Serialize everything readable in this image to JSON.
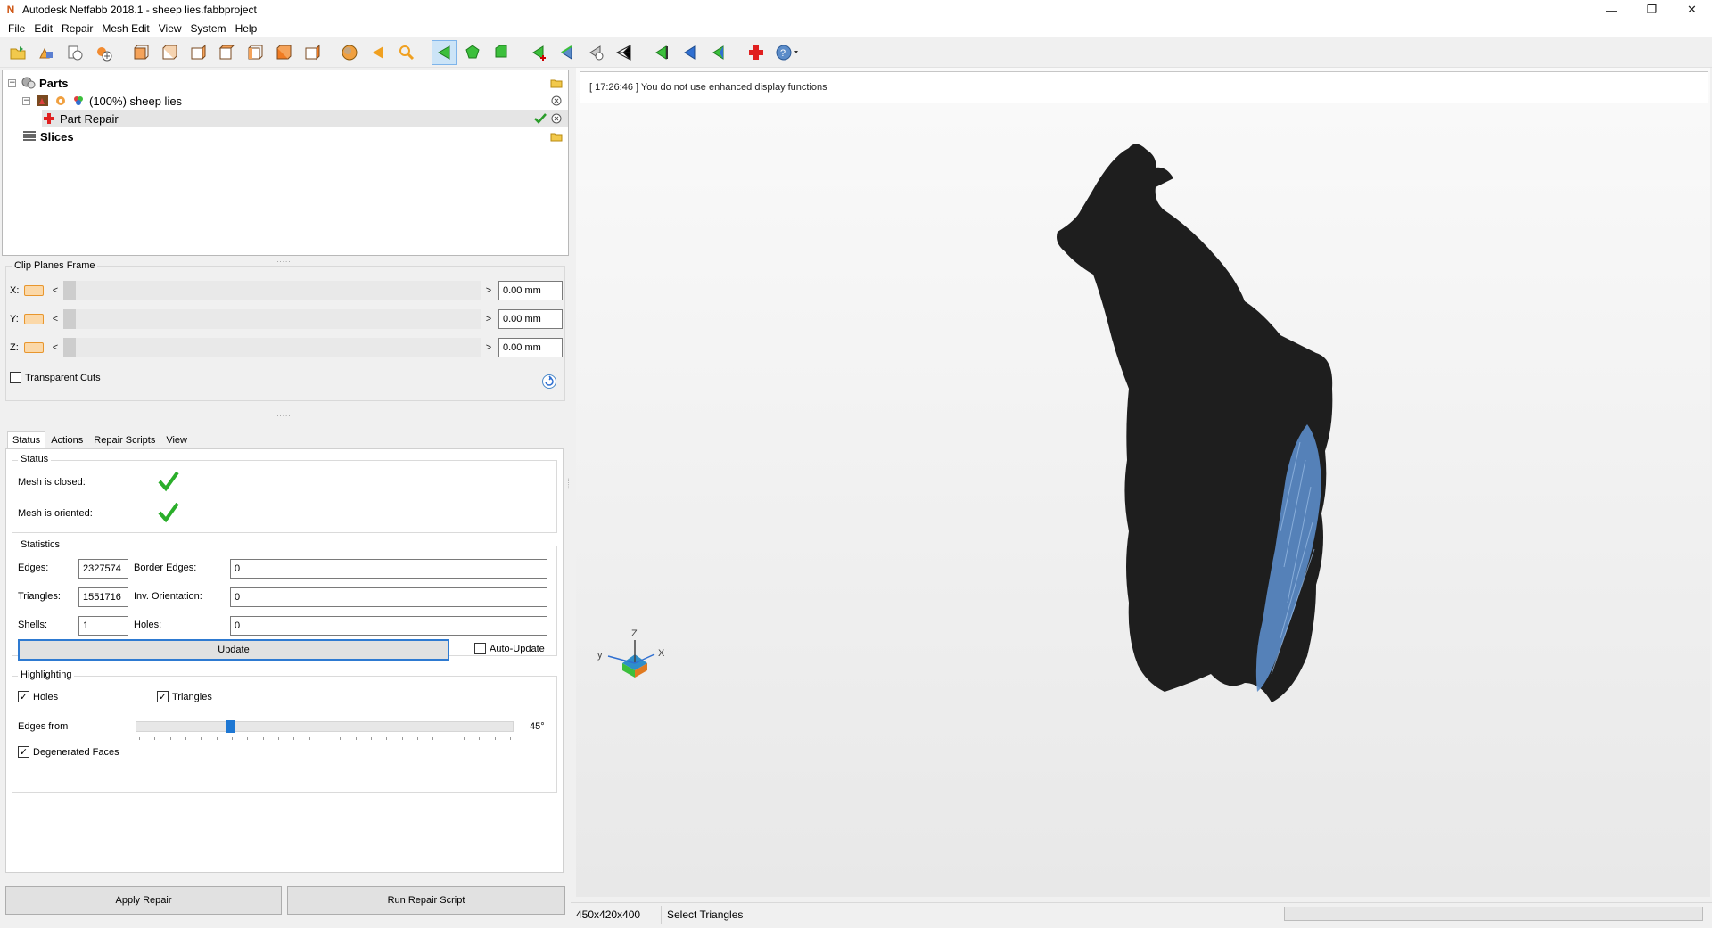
{
  "window": {
    "title": "Autodesk Netfabb 2018.1 - sheep lies.fabbproject",
    "app_logo": "N",
    "controls": {
      "minimize": "—",
      "restore": "❐",
      "close": "✕"
    }
  },
  "menu": [
    "File",
    "Edit",
    "Repair",
    "Mesh Edit",
    "View",
    "System",
    "Help"
  ],
  "toolbar": {
    "icons": [
      "open-project-icon",
      "add-part-icon",
      "import-icon",
      "add-icon",
      "view-front-icon",
      "view-back-icon",
      "view-left-icon",
      "view-right-icon",
      "view-top-icon",
      "view-bottom-icon",
      "view-iso-icon",
      "sphere-icon",
      "arrow-left-icon",
      "zoom-icon",
      "select-triangles-icon",
      "select-surface-icon",
      "select-shell-icon",
      "add-triangle-icon",
      "flip-icon",
      "remove-icon",
      "mesh-edit-icon",
      "nav-left-green-icon",
      "nav-left-blue-icon",
      "nav-left-icon",
      "repair-cross-icon",
      "help-icon"
    ],
    "active_tool": "select-triangles-icon"
  },
  "tree": {
    "parts_label": "Parts",
    "part_label": "(100%) sheep lies",
    "repair_label": "Part Repair",
    "slices_label": "Slices"
  },
  "clip_planes": {
    "title": "Clip Planes Frame",
    "rows": [
      {
        "axis": "X:",
        "value": "0.00 mm"
      },
      {
        "axis": "Y:",
        "value": "0.00 mm"
      },
      {
        "axis": "Z:",
        "value": "0.00 mm"
      }
    ],
    "left_arrow": "<",
    "right_arrow": ">",
    "transparent_cuts_label": "Transparent Cuts",
    "transparent_cuts_checked": false
  },
  "tabs": [
    "Status",
    "Actions",
    "Repair Scripts",
    "View"
  ],
  "active_tab": "Status",
  "status": {
    "group_title": "Status",
    "closed_label": "Mesh is closed:",
    "oriented_label": "Mesh is oriented:"
  },
  "statistics": {
    "group_title": "Statistics",
    "edges_label": "Edges:",
    "edges_value": "2327574",
    "border_edges_label": "Border Edges:",
    "border_edges_value": "0",
    "triangles_label": "Triangles:",
    "triangles_value": "1551716",
    "inv_orientation_label": "Inv. Orientation:",
    "inv_orientation_value": "0",
    "shells_label": "Shells:",
    "shells_value": "1",
    "holes_label": "Holes:",
    "holes_value": "0",
    "update_label": "Update",
    "auto_update_label": "Auto-Update",
    "auto_update_checked": false
  },
  "highlighting": {
    "group_title": "Highlighting",
    "holes_label": "Holes",
    "holes_checked": true,
    "triangles_label": "Triangles",
    "triangles_checked": true,
    "edges_from_label": "Edges from",
    "edges_from_value": "45°",
    "edges_from_fraction": 0.25,
    "degenerated_label": "Degenerated Faces",
    "degenerated_checked": true
  },
  "buttons": {
    "apply_repair": "Apply Repair",
    "run_repair_script": "Run Repair Script"
  },
  "viewport": {
    "log_message": "[ 17:26:46 ] You do not use enhanced display functions",
    "axes": {
      "z": "Z",
      "x": "X",
      "y": "y"
    },
    "model_color": "#1e1e1e",
    "highlight_color": "#5b8cc9"
  },
  "statusbar": {
    "dimensions": "450x420x400",
    "mode": "Select Triangles"
  }
}
